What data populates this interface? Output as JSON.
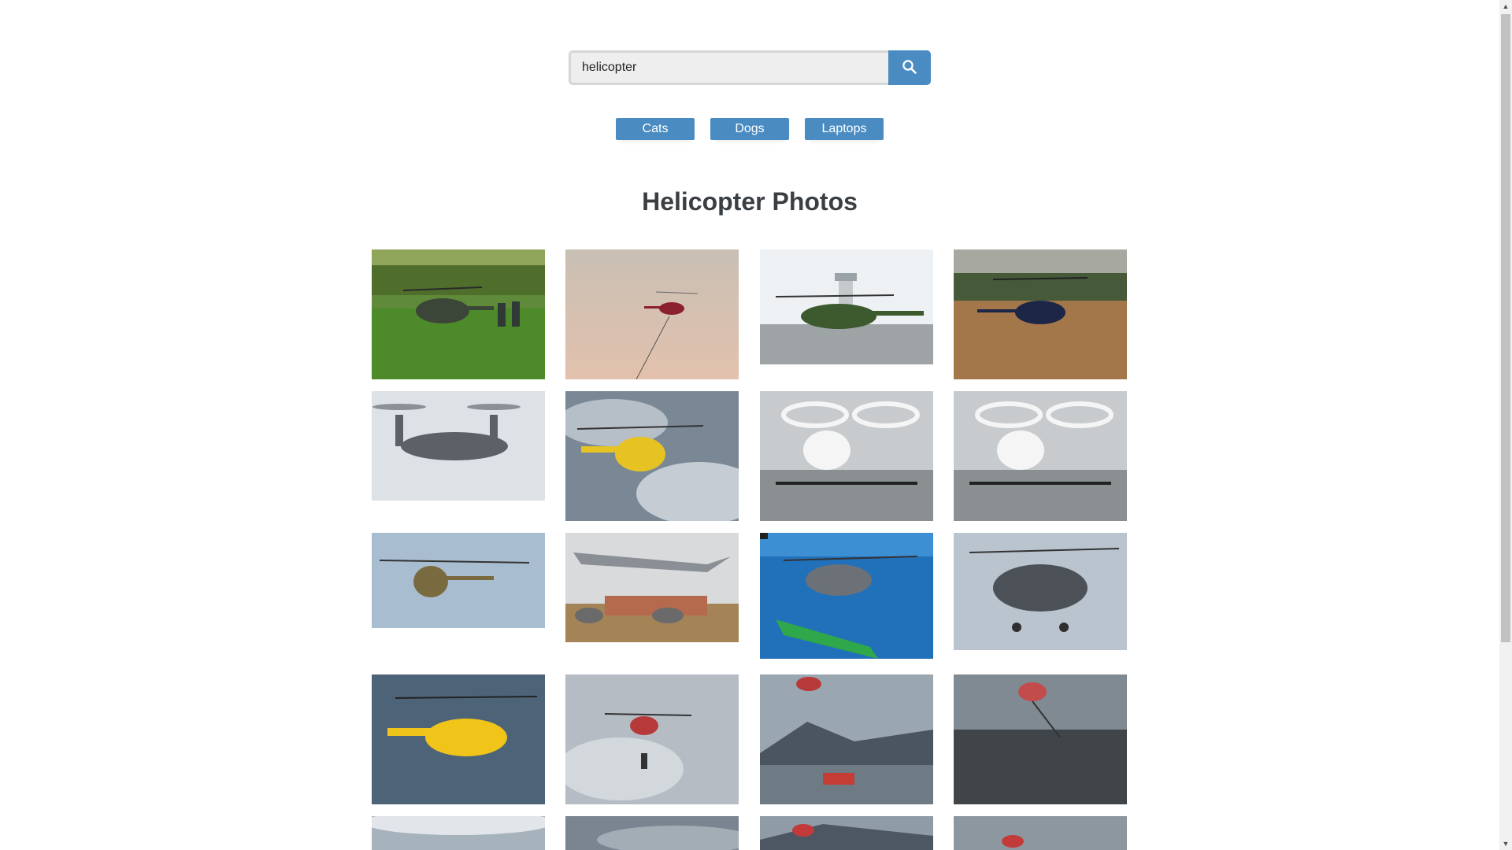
{
  "search": {
    "value": "helicopter",
    "placeholder": ""
  },
  "quick_buttons": [
    {
      "label": "Cats"
    },
    {
      "label": "Dogs"
    },
    {
      "label": "Laptops"
    }
  ],
  "page_title": "Helicopter Photos",
  "icons": {
    "search": "search-icon",
    "scroll_up": "scroll-up-arrow-icon",
    "scroll_down": "scroll-down-arrow-icon"
  },
  "colors": {
    "accent": "#4a8cc2",
    "title": "#3a3f44",
    "input_bg": "#eeeeee"
  },
  "photos": [
    {
      "subject": "military helicopter landed on green grass field with soldiers"
    },
    {
      "subject": "red helicopter flying in hazy sky with bucket line"
    },
    {
      "subject": "green camouflage helicopter on tarmac with control tower"
    },
    {
      "subject": "dark blue helicopter on brown field with trees"
    },
    {
      "subject": "grey tiltrotor aircraft in flight"
    },
    {
      "subject": "yellow rescue helicopter in cloudy sky"
    },
    {
      "subject": "white multicopter air taxi on display"
    },
    {
      "subject": "white multicopter air taxi on display"
    },
    {
      "subject": "camouflage helicopter hovering in blue sky"
    },
    {
      "subject": "fighter jet flying over hangars with helicopters"
    },
    {
      "subject": "military helicopter over sea with ship illustration"
    },
    {
      "subject": "grey attack helicopter close-up in flight"
    },
    {
      "subject": "yellow rescue helicopter against grey sky"
    },
    {
      "subject": "red coast guard helicopter with rescuer on hoist"
    },
    {
      "subject": "red helicopter above mountains and rescue boat"
    },
    {
      "subject": "red helicopter hoisting person over water"
    },
    {
      "subject": "cloudy sky"
    },
    {
      "subject": "cloudy sky"
    },
    {
      "subject": "red helicopter with mountains"
    },
    {
      "subject": "red helicopter in sky"
    }
  ]
}
